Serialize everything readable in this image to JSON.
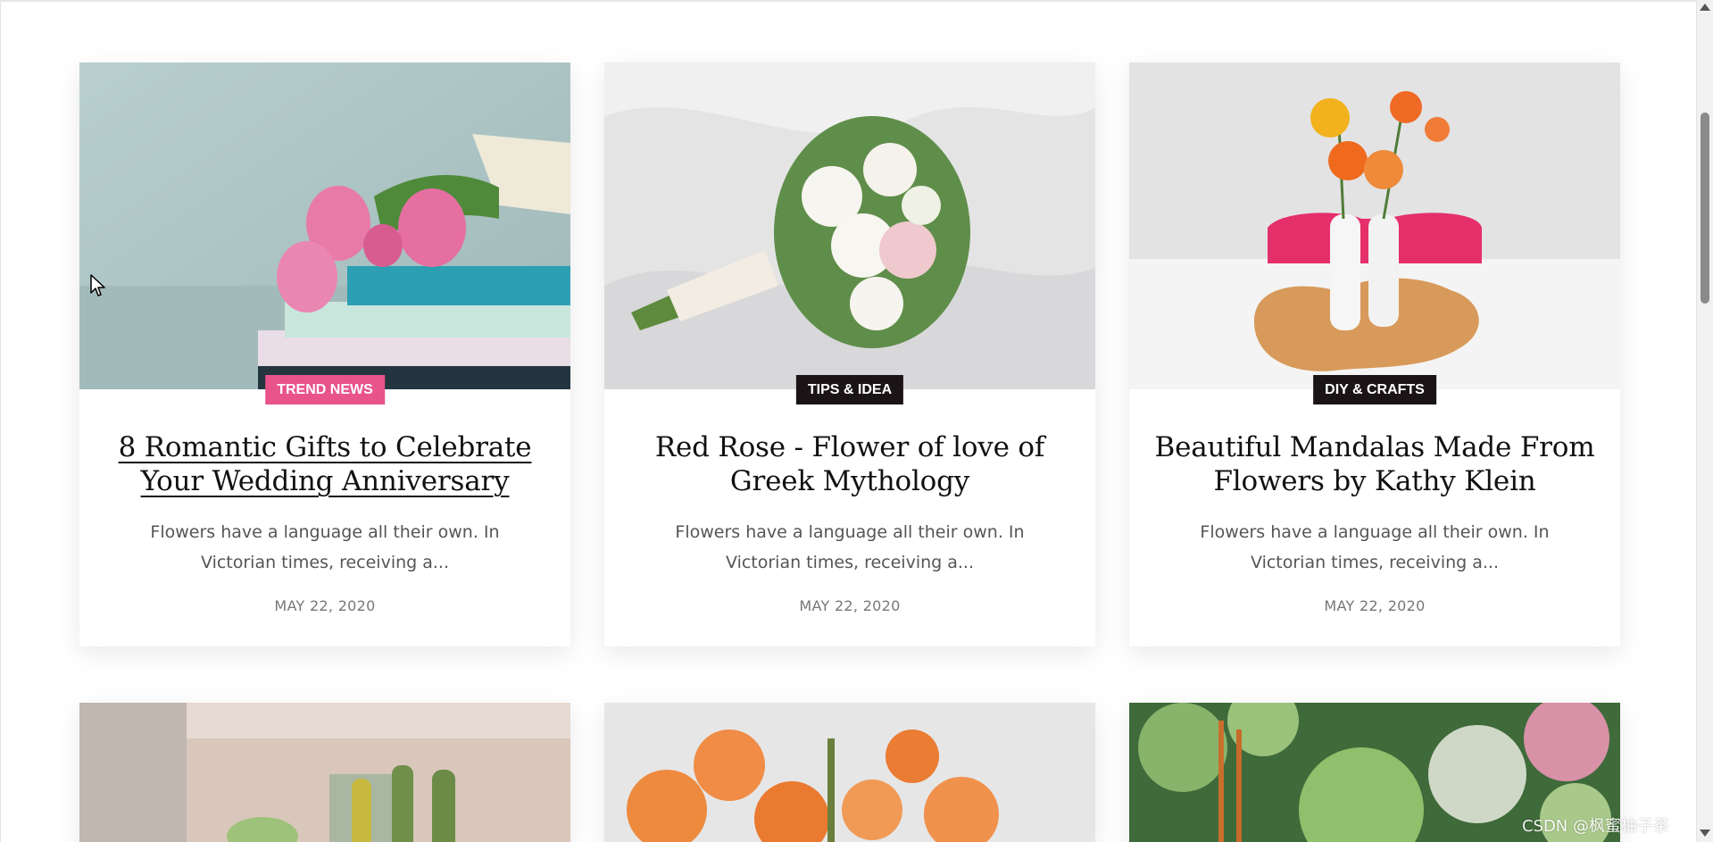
{
  "posts": [
    {
      "category": "TREND NEWS",
      "title": "8 Romantic Gifts to Celebrate Your Wedding Anniversary",
      "excerpt": "Flowers have a language all their own. In Victorian times, receiving a...",
      "date": "MAY 22, 2020",
      "image": "pink-tulips-on-books"
    },
    {
      "category": "TIPS & IDEA",
      "title": "Red Rose - Flower of love of Greek Mythology",
      "excerpt": "Flowers have a language all their own. In Victorian times, receiving a...",
      "date": "MAY 22, 2020",
      "image": "white-bridal-bouquet"
    },
    {
      "category": "DIY & CRAFTS",
      "title": "Beautiful Mandalas Made From Flowers by Kathy Klein",
      "excerpt": "Flowers have a language all their own. In Victorian times, receiving a...",
      "date": "MAY 22, 2020",
      "image": "orange-flowers-in-vases"
    }
  ],
  "next_row_images": [
    "cactus-plants",
    "orange-roses",
    "succulents"
  ],
  "watermark": "CSDN @枫蜜柚子茶",
  "colors": {
    "category_pink": "#e8538a",
    "category_dark": "#1a1416",
    "title": "#111111",
    "excerpt": "#555555",
    "date": "#777777"
  },
  "icons": [
    "mouse-cursor-icon",
    "scroll-up-arrow-icon",
    "scroll-down-arrow-icon"
  ]
}
